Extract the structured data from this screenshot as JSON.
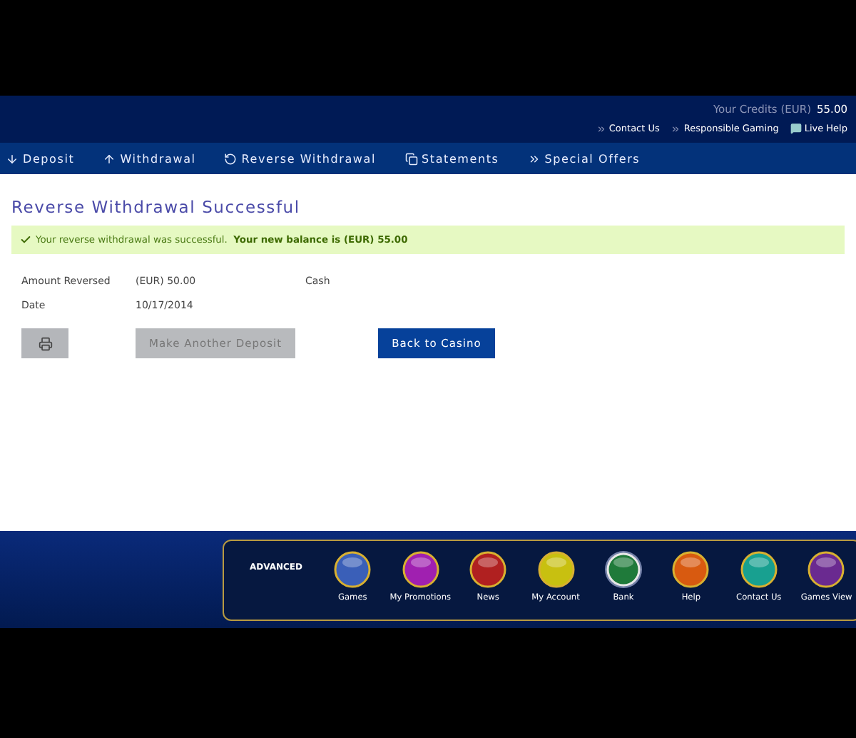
{
  "header": {
    "credits_label": "Your Credits (EUR)",
    "credits_value": "55.00",
    "links": [
      {
        "label": "Contact Us",
        "kind": "chevron"
      },
      {
        "label": "Responsible Gaming",
        "kind": "chevron"
      },
      {
        "label": "Live Help",
        "kind": "chat"
      }
    ]
  },
  "nav": [
    {
      "label": "Deposit",
      "kind": "down"
    },
    {
      "label": "Withdrawal",
      "kind": "up"
    },
    {
      "label": "Reverse Withdrawal",
      "kind": "reverse"
    },
    {
      "label": "Statements",
      "kind": "doc"
    },
    {
      "label": "Special Offers",
      "kind": "chevron"
    }
  ],
  "page_title": "Reverse Withdrawal Successful",
  "alert": "Your reverse withdrawal was successful.  **Your new balance is (EUR) 55.00**",
  "details": [
    {
      "label": "Amount Reversed",
      "value": "(EUR) 50.00",
      "extra": "Cash"
    },
    {
      "label": "Date",
      "value": "10/17/2014"
    }
  ],
  "buttons": [
    {
      "kind": "print"
    },
    {
      "kind": "disabled",
      "label": "Make Another Deposit"
    },
    {
      "kind": "primary",
      "label": "Back to Casino"
    }
  ],
  "dock": {
    "label": "ADVANCED",
    "items": [
      {
        "label": "Games",
        "color": "#3a5fb8",
        "selected": false
      },
      {
        "label": "My Promotions",
        "color": "#a020b0",
        "selected": false
      },
      {
        "label": "News",
        "color": "#b02020",
        "selected": false
      },
      {
        "label": "My Account",
        "color": "#c8c010",
        "selected": false
      },
      {
        "label": "Bank",
        "color": "#1f7a3a",
        "selected": true
      },
      {
        "label": "Help",
        "color": "#d85a10",
        "selected": false
      },
      {
        "label": "Contact Us",
        "color": "#18a090",
        "selected": false
      },
      {
        "label": "Games View",
        "color": "#6a2a90",
        "selected": false
      }
    ]
  }
}
